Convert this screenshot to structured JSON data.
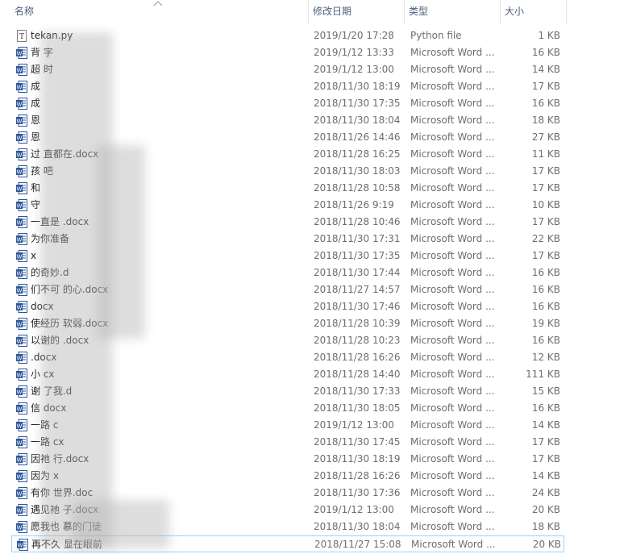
{
  "columns": {
    "name": "名称",
    "date": "修改日期",
    "type": "类型",
    "size": "大小"
  },
  "icons": {
    "word": "word-document-icon",
    "python": "python-file-icon",
    "sort": "sort-ascending-chevron-icon"
  },
  "colors": {
    "word_blue": "#2b579a",
    "selection_border": "#99d1ff",
    "header_text": "#4c607a"
  },
  "files": [
    {
      "name": "tekan.py",
      "date": "2019/1/20 17:28",
      "type": "Python file",
      "size": "1 KB",
      "icon": "python"
    },
    {
      "name": "背              字",
      "date": "2019/1/12 13:33",
      "type": "Microsoft Word ...",
      "size": "16 KB",
      "icon": "word"
    },
    {
      "name": "超              时",
      "date": "2019/1/12 13:00",
      "type": "Microsoft Word ...",
      "size": "14 KB",
      "icon": "word"
    },
    {
      "name": "成",
      "date": "2018/11/30 18:19",
      "type": "Microsoft Word ...",
      "size": "17 KB",
      "icon": "word"
    },
    {
      "name": "成",
      "date": "2018/11/30 17:35",
      "type": "Microsoft Word ...",
      "size": "16 KB",
      "icon": "word"
    },
    {
      "name": "恩",
      "date": "2018/11/30 18:04",
      "type": "Microsoft Word ...",
      "size": "18 KB",
      "icon": "word"
    },
    {
      "name": "恩",
      "date": "2018/11/26 14:46",
      "type": "Microsoft Word ...",
      "size": "27 KB",
      "icon": "word"
    },
    {
      "name": "过              直都在.docx",
      "date": "2018/11/28 16:25",
      "type": "Microsoft Word ...",
      "size": "11 KB",
      "icon": "word"
    },
    {
      "name": "孩              吧",
      "date": "2018/11/30 18:03",
      "type": "Microsoft Word ...",
      "size": "17 KB",
      "icon": "word"
    },
    {
      "name": "和",
      "date": "2018/11/28 10:58",
      "type": "Microsoft Word ...",
      "size": "17 KB",
      "icon": "word"
    },
    {
      "name": "守",
      "date": "2018/11/26 9:19",
      "type": "Microsoft Word ...",
      "size": "10 KB",
      "icon": "word"
    },
    {
      "name": "              一直是              .docx",
      "date": "2018/11/28 10:46",
      "type": "Microsoft Word ...",
      "size": "17 KB",
      "icon": "word"
    },
    {
      "name": "              为你准备",
      "date": "2018/11/30 17:31",
      "type": "Microsoft Word ...",
      "size": "22 KB",
      "icon": "word"
    },
    {
      "name": "              x",
      "date": "2018/11/30 17:35",
      "type": "Microsoft Word ...",
      "size": "17 KB",
      "icon": "word"
    },
    {
      "name": "              的奇妙.d",
      "date": "2018/11/30 17:44",
      "type": "Microsoft Word ...",
      "size": "16 KB",
      "icon": "word"
    },
    {
      "name": "              们不可              的心.docx",
      "date": "2018/11/27 14:57",
      "type": "Microsoft Word ...",
      "size": "16 KB",
      "icon": "word"
    },
    {
      "name": "              docx",
      "date": "2018/11/30 17:46",
      "type": "Microsoft Word ...",
      "size": "16 KB",
      "icon": "word"
    },
    {
      "name": "              使经历              软弱.docx",
      "date": "2018/11/28 10:39",
      "type": "Microsoft Word ...",
      "size": "19 KB",
      "icon": "word"
    },
    {
      "name": "              以谢的              .docx",
      "date": "2018/11/28 10:23",
      "type": "Microsoft Word ...",
      "size": "16 KB",
      "icon": "word"
    },
    {
      "name": "              .docx",
      "date": "2018/11/28 16:26",
      "type": "Microsoft Word ...",
      "size": "12 KB",
      "icon": "word"
    },
    {
      "name": "小              cx",
      "date": "2018/11/28 14:40",
      "type": "Microsoft Word ...",
      "size": "111 KB",
      "icon": "word"
    },
    {
      "name": "谢              了我.d",
      "date": "2018/11/30 17:33",
      "type": "Microsoft Word ...",
      "size": "15 KB",
      "icon": "word"
    },
    {
      "name": "信              docx",
      "date": "2018/11/30 18:05",
      "type": "Microsoft Word ...",
      "size": "16 KB",
      "icon": "word"
    },
    {
      "name": "一路              c",
      "date": "2019/1/12 13:00",
      "type": "Microsoft Word ...",
      "size": "14 KB",
      "icon": "word"
    },
    {
      "name": "一路              cx",
      "date": "2018/11/30 17:45",
      "type": "Microsoft Word ...",
      "size": "17 KB",
      "icon": "word"
    },
    {
      "name": "因祂              行.docx",
      "date": "2018/11/30 18:19",
      "type": "Microsoft Word ...",
      "size": "17 KB",
      "icon": "word"
    },
    {
      "name": "因为              x",
      "date": "2018/11/28 16:26",
      "type": "Microsoft Word ...",
      "size": "14 KB",
      "icon": "word"
    },
    {
      "name": "有你              世界.doc",
      "date": "2018/11/30 17:36",
      "type": "Microsoft Word ...",
      "size": "24 KB",
      "icon": "word"
    },
    {
      "name": "遇见祂              子.docx",
      "date": "2019/1/12 13:00",
      "type": "Microsoft Word ...",
      "size": "20 KB",
      "icon": "word"
    },
    {
      "name": "愿我也              慕的门徒",
      "date": "2018/11/30 18:04",
      "type": "Microsoft Word ...",
      "size": "18 KB",
      "icon": "word"
    },
    {
      "name": "再不久              显在眼前",
      "date": "2018/11/27 15:08",
      "type": "Microsoft Word ...",
      "size": "20 KB",
      "icon": "word"
    }
  ]
}
